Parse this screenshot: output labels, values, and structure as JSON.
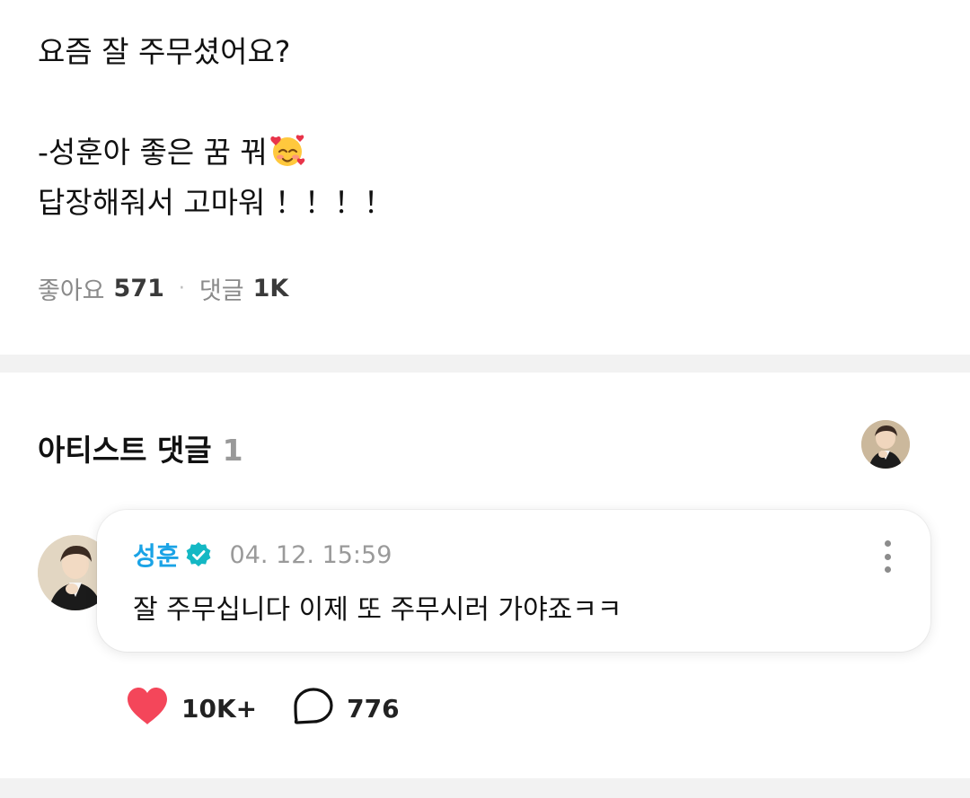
{
  "post": {
    "lines": [
      "요즘 잘 주무셨어요?",
      "",
      "-성훈아 좋은 꿈 꿔",
      "답장해줘서 고마워 ！！！！"
    ],
    "emoji": "smiling-face-with-hearts-icon",
    "likes_label": "좋아요",
    "likes_count": "571",
    "separator": "·",
    "comments_label": "댓글",
    "comments_count": "1K"
  },
  "artist_comments": {
    "title": "아티스트 댓글",
    "count": "1",
    "comment": {
      "author": "성훈",
      "verified_icon": "verified-badge-icon",
      "timestamp": "04. 12. 15:59",
      "text": "잘 주무십니다 이제 또 주무시러 가야죠ㅋㅋ",
      "like_count": "10K+",
      "reply_count": "776"
    }
  },
  "colors": {
    "accent_blue": "#1aa3e6",
    "heart_red": "#f4465a",
    "divider_gray": "#f2f2f2"
  }
}
